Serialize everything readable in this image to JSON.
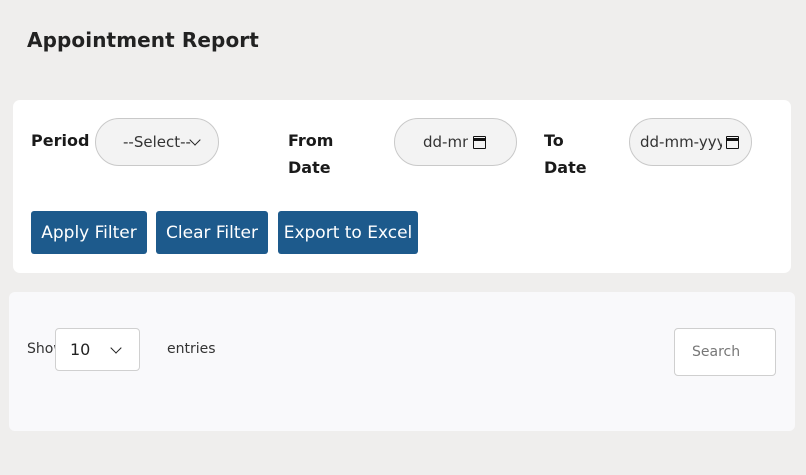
{
  "page": {
    "title": "Appointment Report"
  },
  "filters": {
    "period_label": "Period",
    "period_value": "--Select--",
    "from_label": "From Date",
    "from_placeholder": "dd-mm-yyyy",
    "to_label": "To Date",
    "to_placeholder": "dd-mm-yyyy"
  },
  "actions": {
    "apply": "Apply Filter",
    "clear": "Clear Filter",
    "export": "Export to Excel"
  },
  "table": {
    "show_label": "Show",
    "length_value": "10",
    "entries_label": "entries",
    "search_placeholder": "Search"
  },
  "colors": {
    "primary_button": "#1d5a8c",
    "page_background": "#efeeed"
  },
  "icons": [
    "chevron-down-icon",
    "calendar-icon"
  ]
}
